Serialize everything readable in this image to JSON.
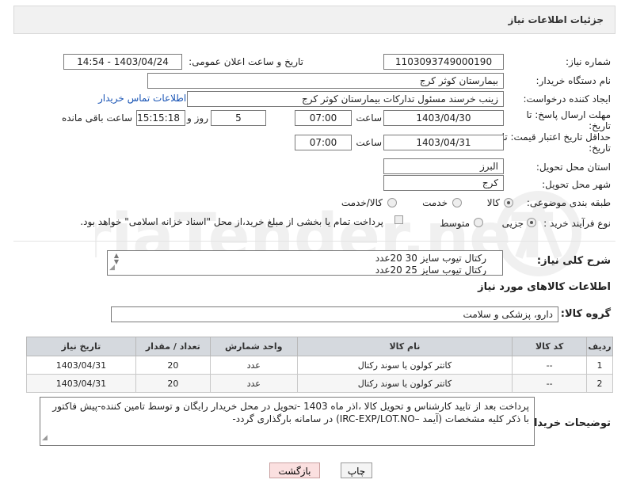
{
  "header": {
    "title": "جزئیات اطلاعات نیاز"
  },
  "form": {
    "need_number": {
      "label": "شماره نیاز:",
      "value": "1103093749000190"
    },
    "announce_datetime": {
      "label": "تاریخ و ساعت اعلان عمومی:",
      "value": "1403/04/24 - 14:54"
    },
    "buyer_org": {
      "label": "نام دستگاه خریدار:",
      "value": "بیمارستان کوثر کرج"
    },
    "requester": {
      "label": "ایجاد کننده درخواست:",
      "value": "زینب خرسند مسئول تدارکات بیمارستان کوثر کرج"
    },
    "buyer_contact_link": "اطلاعات تماس خریدار",
    "reply_deadline": {
      "label_line1": "مهلت ارسال پاسخ: تا",
      "label_line2": "تاریخ:",
      "date": "1403/04/30",
      "time_label": "ساعت",
      "time": "07:00",
      "days": "5",
      "days_label": "روز و",
      "remaining": "15:15:18",
      "remaining_label": "ساعت باقی مانده"
    },
    "price_validity": {
      "label_line1": "حداقل تاریخ اعتبار قیمت: تا",
      "label_line2": "تاریخ:",
      "date": "1403/04/31",
      "time_label": "ساعت",
      "time": "07:00"
    },
    "delivery_province": {
      "label": "استان محل تحویل:",
      "value": "البرز"
    },
    "delivery_city": {
      "label": "شهر محل تحویل:",
      "value": "کرج"
    },
    "category": {
      "label": "طبقه بندی موضوعی:",
      "options": [
        "کالا",
        "خدمت",
        "کالا/خدمت"
      ],
      "selected": "کالا"
    },
    "purchase_process": {
      "label": "نوع فرآیند خرید :",
      "options": [
        "جزیی",
        "متوسط"
      ],
      "selected": "جزیی",
      "payment_note": "پرداخت تمام یا بخشی از مبلغ خرید،از محل \"اسناد خزانه اسلامی\" خواهد بود."
    },
    "general_description": {
      "label": "شرح کلی نیاز:",
      "lines": [
        "رکتال تیوب سایز 30     20عدد",
        "رکتال تیوب سایز 25     20عدد"
      ]
    }
  },
  "goods_section": {
    "title": "اطلاعات کالاهای مورد نیاز",
    "group_label": "گروه کالا:",
    "group_value": "دارو، پزشکی و سلامت",
    "columns": [
      "ردیف",
      "کد کالا",
      "نام کالا",
      "واحد شمارش",
      "تعداد / مقدار",
      "تاریخ نیاز"
    ],
    "rows": [
      [
        "1",
        "--",
        "کاتتر کولون یا سوند رکتال",
        "عدد",
        "20",
        "1403/04/31"
      ],
      [
        "2",
        "--",
        "کاتتر کولون یا سوند رکتال",
        "عدد",
        "20",
        "1403/04/31"
      ]
    ]
  },
  "buyer_notes": {
    "label": "توضیحات خریدار:",
    "text": "پرداخت بعد از تایید کارشناس و تحویل کالا ،اذر ماه 1403 -تحویل در محل خریدار رایگان و توسط تامین کننده-پیش فاکتور با ذکر کلیه مشخصات (آیمد –IRC-EXP/LOT.NO) در سامانه بارگذاری گردد-"
  },
  "buttons": {
    "print": "چاپ",
    "back": "بازگشت"
  },
  "watermark_text": "AriaTender.neT"
}
